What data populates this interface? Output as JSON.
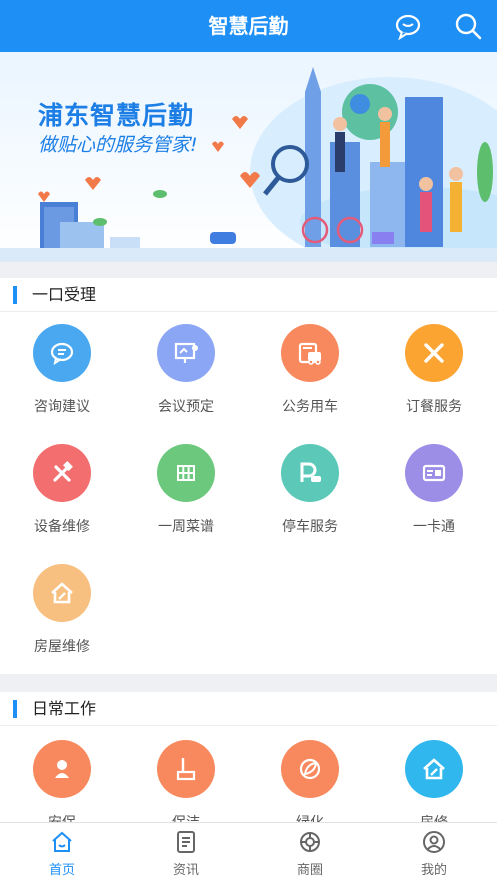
{
  "header": {
    "title": "智慧后勤"
  },
  "banner": {
    "title": "浦东智慧后勤",
    "subtitle": "做贴心的服务管家!"
  },
  "sections": [
    {
      "title": "一口受理",
      "items": [
        {
          "label": "咨询建议",
          "icon": "chat-icon",
          "color": "#4aa8f0"
        },
        {
          "label": "会议预定",
          "icon": "meeting-icon",
          "color": "#8ba6f4"
        },
        {
          "label": "公务用车",
          "icon": "car-icon",
          "color": "#f8895e"
        },
        {
          "label": "订餐服务",
          "icon": "utensils-icon",
          "color": "#fba432"
        },
        {
          "label": "设备维修",
          "icon": "tools-icon",
          "color": "#f36f6f"
        },
        {
          "label": "一周菜谱",
          "icon": "grid-icon",
          "color": "#6cc87c"
        },
        {
          "label": "停车服务",
          "icon": "parking-icon",
          "color": "#5bc8b8"
        },
        {
          "label": "一卡通",
          "icon": "card-icon",
          "color": "#9c8ee6"
        },
        {
          "label": "房屋维修",
          "icon": "house-repair-icon",
          "color": "#f8c080"
        }
      ]
    },
    {
      "title": "日常工作",
      "items": [
        {
          "label": "安保",
          "icon": "security-icon",
          "color": "#f8895e"
        },
        {
          "label": "保洁",
          "icon": "cleaning-icon",
          "color": "#f8895e"
        },
        {
          "label": "绿化",
          "icon": "leaf-icon",
          "color": "#f8895e"
        },
        {
          "label": "房修",
          "icon": "house-icon",
          "color": "#30b8ee"
        }
      ]
    }
  ],
  "tabs": [
    {
      "label": "首页",
      "icon": "home-icon",
      "active": true
    },
    {
      "label": "资讯",
      "icon": "news-icon",
      "active": false
    },
    {
      "label": "商圈",
      "icon": "shop-icon",
      "active": false
    },
    {
      "label": "我的",
      "icon": "user-icon",
      "active": false
    }
  ],
  "colors": {
    "primary": "#1e8ff5",
    "background": "#eef0f4"
  }
}
